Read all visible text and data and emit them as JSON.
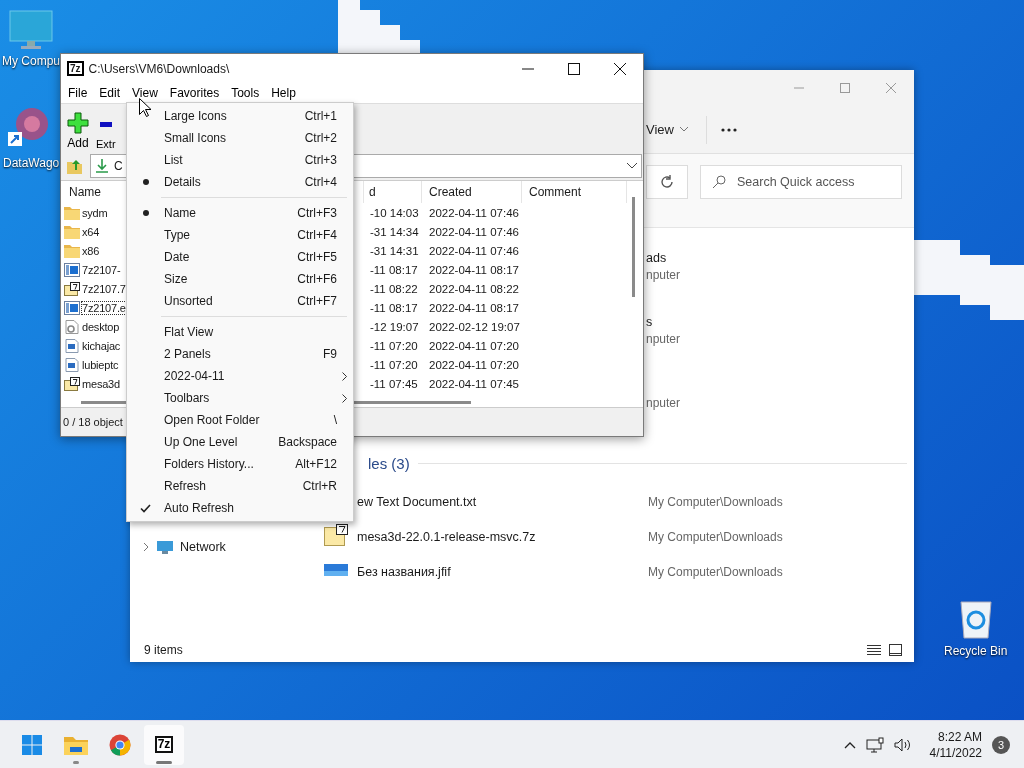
{
  "desktop_icons": [
    {
      "label": "My Compu",
      "kind": "computer"
    },
    {
      "label": "DataWago",
      "kind": "shortcut"
    },
    {
      "label": "Recycle Bin",
      "kind": "recycle"
    }
  ],
  "explorer": {
    "view_label": "View",
    "search": {
      "placeholder": "Search Quick access"
    },
    "quick_access": [
      {
        "title": "ads",
        "subtitle": "nputer"
      },
      {
        "title": "s",
        "subtitle": "nputer"
      },
      {
        "subtitle": "nputer"
      }
    ],
    "files_heading": "les (3)",
    "files": [
      {
        "name": "ew Text Document.txt",
        "location": "My Computer\\Downloads"
      },
      {
        "name": "mesa3d-22.0.1-release-msvc.7z",
        "location": "My Computer\\Downloads",
        "kind": "archive"
      },
      {
        "name": "Без названия.jfif",
        "location": "My Computer\\Downloads",
        "kind": "image"
      }
    ],
    "nav": [
      {
        "label": "Network",
        "expanded": false
      }
    ],
    "status": "9 items"
  },
  "sevenzip": {
    "icon_text": "7z",
    "title": "C:\\Users\\VM6\\Downloads\\",
    "menubar": [
      "File",
      "Edit",
      "View",
      "Favorites",
      "Tools",
      "Help"
    ],
    "toolbar": [
      {
        "label": "Add",
        "kind": "add"
      },
      {
        "label": "Extr",
        "kind": "extract"
      }
    ],
    "address": "C",
    "columns": [
      "Name",
      "d",
      "Created",
      "Comment"
    ],
    "rows": [
      {
        "name": "sydm",
        "kind": "folder",
        "modified": "-10 14:03",
        "created": "2022-04-11 07:46",
        "focused": false
      },
      {
        "name": "x64",
        "kind": "folder",
        "modified": "-31 14:34",
        "created": "2022-04-11 07:46",
        "focused": false
      },
      {
        "name": "x86",
        "kind": "folder",
        "modified": "-31 14:31",
        "created": "2022-04-11 07:46",
        "focused": false
      },
      {
        "name": "7z2107-",
        "kind": "exe",
        "modified": "-11 08:17",
        "created": "2022-04-11 08:17",
        "focused": false
      },
      {
        "name": "7z2107.7",
        "kind": "archive",
        "modified": "-11 08:22",
        "created": "2022-04-11 08:22",
        "focused": false
      },
      {
        "name": "7z2107.e",
        "kind": "exe",
        "modified": "-11 08:17",
        "created": "2022-04-11 08:17",
        "focused": true
      },
      {
        "name": "desktop",
        "kind": "settings",
        "modified": "-12 19:07",
        "created": "2022-02-12 19:07",
        "focused": false
      },
      {
        "name": "kichajac",
        "kind": "image",
        "modified": "-11 07:20",
        "created": "2022-04-11 07:20",
        "focused": false
      },
      {
        "name": "lubieptc",
        "kind": "image",
        "modified": "-11 07:20",
        "created": "2022-04-11 07:20",
        "focused": false
      },
      {
        "name": "mesa3d",
        "kind": "archive",
        "modified": "-11 07:45",
        "created": "2022-04-11 07:45",
        "focused": false
      }
    ],
    "status": "0 / 18 object",
    "view_menu": {
      "items": [
        {
          "kind": "radio",
          "label": "Large Icons",
          "shortcut": "Ctrl+1",
          "checked": false
        },
        {
          "kind": "radio",
          "label": "Small Icons",
          "shortcut": "Ctrl+2",
          "checked": false
        },
        {
          "kind": "radio",
          "label": "List",
          "shortcut": "Ctrl+3",
          "checked": false
        },
        {
          "kind": "radio",
          "label": "Details",
          "shortcut": "Ctrl+4",
          "checked": true
        },
        {
          "kind": "separator"
        },
        {
          "kind": "radio",
          "label": "Name",
          "shortcut": "Ctrl+F3",
          "checked": true
        },
        {
          "kind": "radio",
          "label": "Type",
          "shortcut": "Ctrl+F4",
          "checked": false
        },
        {
          "kind": "radio",
          "label": "Date",
          "shortcut": "Ctrl+F5",
          "checked": false
        },
        {
          "kind": "radio",
          "label": "Size",
          "shortcut": "Ctrl+F6",
          "checked": false
        },
        {
          "kind": "radio",
          "label": "Unsorted",
          "shortcut": "Ctrl+F7",
          "checked": false
        },
        {
          "kind": "separator"
        },
        {
          "kind": "check",
          "label": "Flat View",
          "checked": false
        },
        {
          "kind": "check",
          "label": "2 Panels",
          "shortcut": "F9",
          "checked": false
        },
        {
          "kind": "submenu",
          "label": "2022-04-11"
        },
        {
          "kind": "submenu",
          "label": "Toolbars"
        },
        {
          "kind": "plain",
          "label": "Open Root Folder",
          "shortcut": "\\"
        },
        {
          "kind": "plain",
          "label": "Up One Level",
          "shortcut": "Backspace"
        },
        {
          "kind": "plain",
          "label": "Folders History...",
          "shortcut": "Alt+F12"
        },
        {
          "kind": "plain",
          "label": "Refresh",
          "shortcut": "Ctrl+R"
        },
        {
          "kind": "check",
          "label": "Auto Refresh",
          "checked": true
        }
      ]
    }
  },
  "taskbar": {
    "apps": [
      {
        "kind": "explorer",
        "running": true,
        "active": false
      },
      {
        "kind": "browser",
        "running": false,
        "active": false
      },
      {
        "kind": "sevenzip",
        "label": "7z",
        "running": true,
        "active": true
      }
    ],
    "time": "8:22 AM",
    "date": "4/11/2022",
    "notifications": "3"
  }
}
